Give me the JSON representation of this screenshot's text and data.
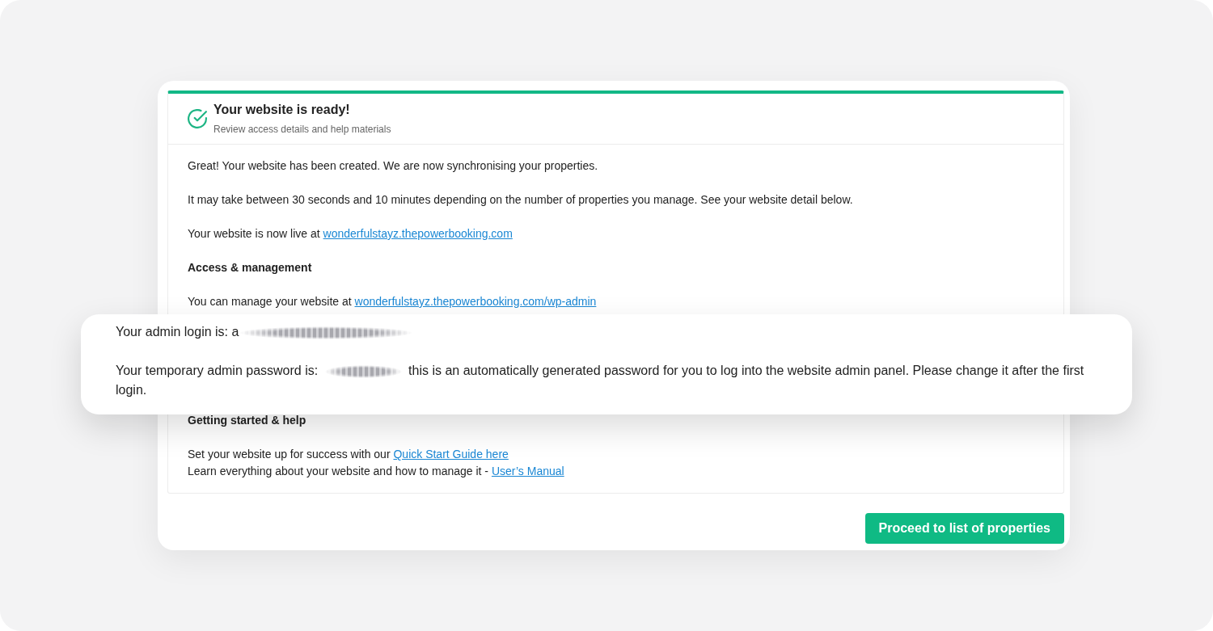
{
  "card": {
    "header": {
      "title": "Your website is ready!",
      "subtitle": "Review access details and help materials"
    },
    "body": [
      {
        "kind": "text",
        "text": "Great! Your website has been created. We are now synchronising your properties."
      },
      {
        "kind": "text",
        "text": "It may take between 30 seconds and 10 minutes depending on the number of properties you manage. See your website detail below."
      },
      {
        "kind": "link_text",
        "text": "Your website is now live at",
        "link": "wonderfulstayz.thepowerbooking.com"
      },
      {
        "kind": "heading",
        "text": "Access & management"
      },
      {
        "kind": "link_text",
        "text": "You can manage your website at",
        "link": "wonderfulstayz.thepowerbooking.com/wp-admin"
      }
    ],
    "help": {
      "heading": "Getting started & help",
      "lines": [
        {
          "text": "Set your website up for success with our",
          "link": "Quick Start Guide here"
        },
        {
          "text": "Learn everything about your website and how to manage it -",
          "link": "User’s Manual"
        }
      ]
    }
  },
  "callout": {
    "login": {
      "label": "Your admin login is: a"
    },
    "password": {
      "label": "Your temporary admin password is:",
      "note": "this is an automatically generated password for you to log into the website admin panel. Please change it after the first login."
    }
  },
  "button": "Proceed to list of properties"
}
